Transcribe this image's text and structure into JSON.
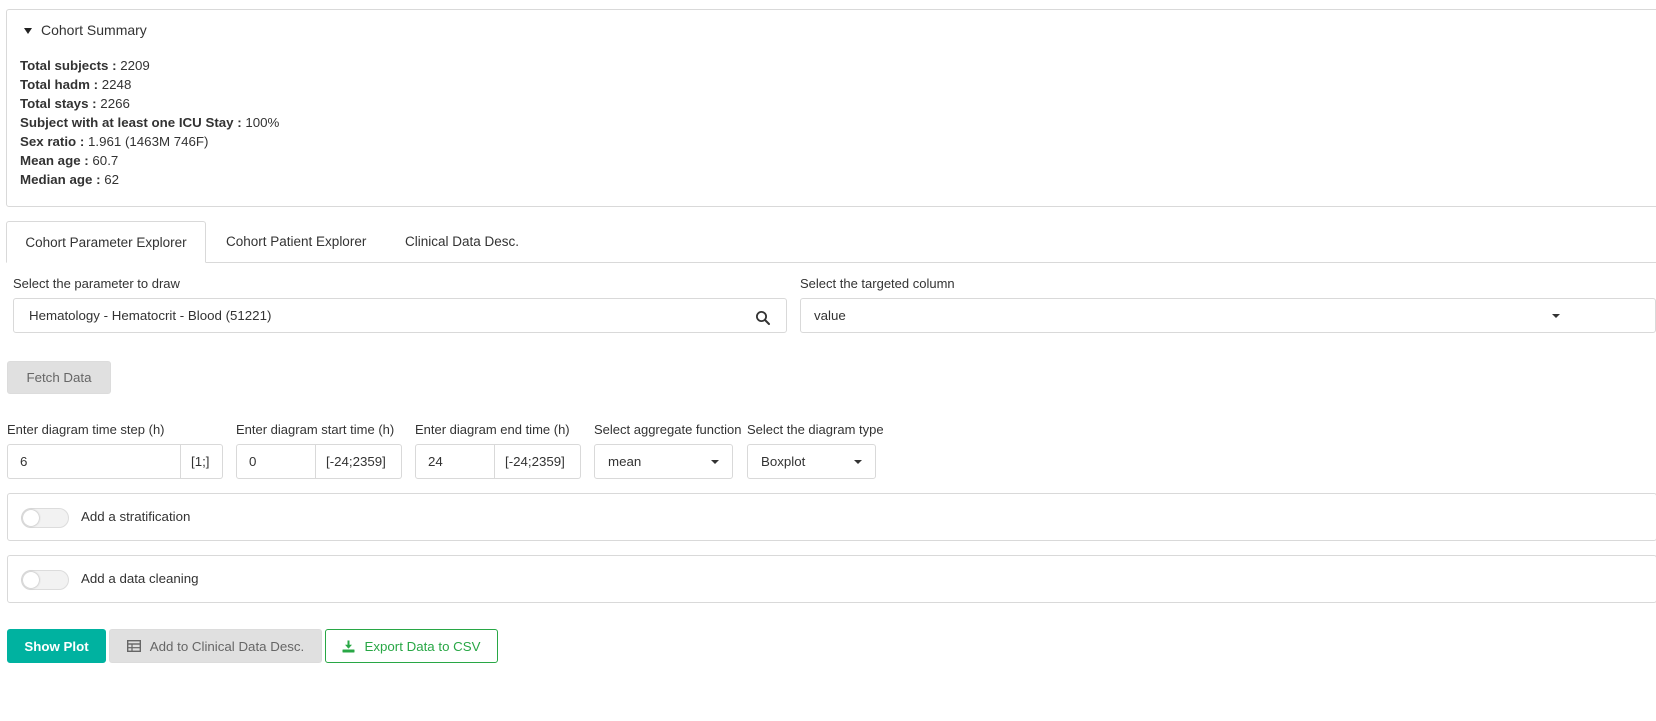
{
  "summary": {
    "title": "Cohort Summary",
    "lines": [
      {
        "label": "Total subjects :",
        "value": " 2209"
      },
      {
        "label": "Total hadm :",
        "value": " 2248"
      },
      {
        "label": "Total stays :",
        "value": " 2266"
      },
      {
        "label": "Subject with at least one ICU Stay :",
        "value": " 100%"
      },
      {
        "label": "Sex ratio :",
        "value": " 1.961 (1463M 746F)"
      },
      {
        "label": "Mean age :",
        "value": " 60.7"
      },
      {
        "label": "Median age :",
        "value": " 62"
      }
    ]
  },
  "tabs": [
    {
      "label": "Cohort Parameter Explorer",
      "active": true
    },
    {
      "label": "Cohort Patient Explorer",
      "active": false
    },
    {
      "label": "Clinical Data Desc.",
      "active": false
    }
  ],
  "parameter": {
    "label": "Select the parameter to draw",
    "value": "Hematology - Hematocrit - Blood (51221)"
  },
  "column": {
    "label": "Select the targeted column",
    "value": "value"
  },
  "fetch_label": "Fetch Data",
  "time_step": {
    "label": "Enter diagram time step (h)",
    "value": "6",
    "range": "[1;]"
  },
  "start_time": {
    "label": "Enter diagram start time (h)",
    "value": "0",
    "range": "[-24;2359]"
  },
  "end_time": {
    "label": "Enter diagram end time (h)",
    "value": "24",
    "range": "[-24;2359]"
  },
  "aggregate": {
    "label": "Select aggregate function",
    "value": "mean"
  },
  "diagram_type": {
    "label": "Select the diagram type",
    "value": "Boxplot"
  },
  "stratification_label": "Add a stratification",
  "cleaning_label": "Add a data cleaning",
  "actions": {
    "show_plot": "Show Plot",
    "add_clinical": "Add to Clinical Data Desc.",
    "export_csv": "Export Data to CSV"
  },
  "colors": {
    "primary": "#00b2a0",
    "success": "#28a745",
    "disabled": "#e0e0e0",
    "border": "#d9d9d9"
  },
  "icons": {
    "search": "search-icon",
    "table": "table-icon",
    "download": "download-icon",
    "caret": "caret-down-icon"
  }
}
